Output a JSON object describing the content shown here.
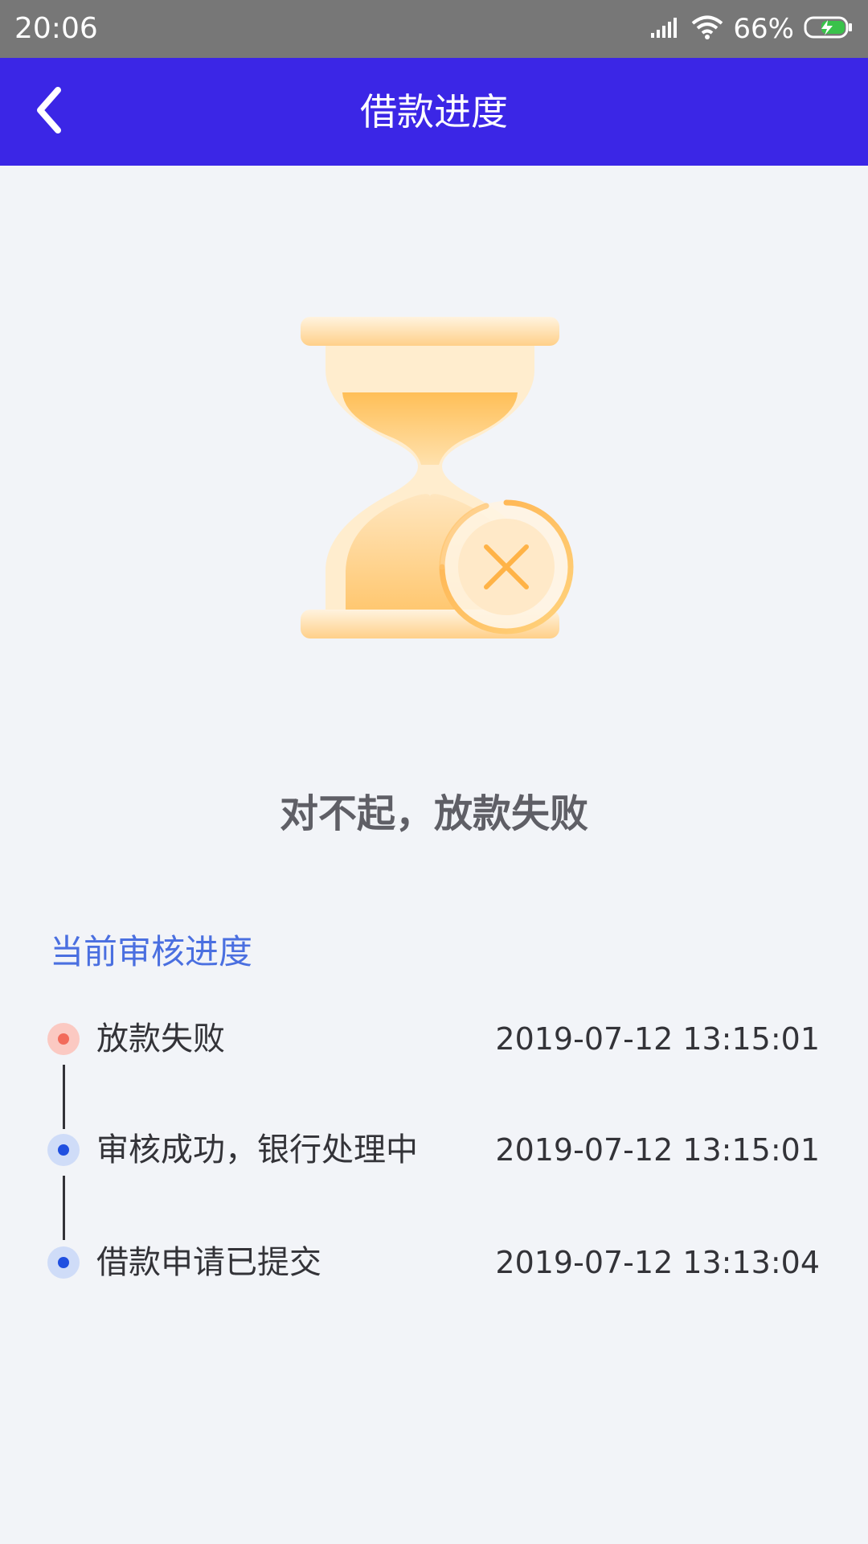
{
  "status_bar": {
    "time": "20:06",
    "battery_percent": "66%",
    "icons": [
      "signal-icon",
      "wifi-icon",
      "battery-charging-icon"
    ]
  },
  "nav": {
    "back_icon": "back-chevron-icon",
    "title": "借款进度"
  },
  "illustration": {
    "icon": "hourglass-failed-icon"
  },
  "result": {
    "title": "对不起，放款失败"
  },
  "progress": {
    "section_title": "当前审核进度",
    "items": [
      {
        "label": "放款失败",
        "time": "2019-07-12 13:15:01",
        "status": "failed"
      },
      {
        "label": "审核成功，银行处理中",
        "time": "2019-07-12 13:15:01",
        "status": "done"
      },
      {
        "label": "借款申请已提交",
        "time": "2019-07-12 13:13:04",
        "status": "done"
      }
    ]
  },
  "colors": {
    "nav_background": "#3b26e6",
    "status_bar": "#777777",
    "page_background": "#f2f4f8",
    "section_title": "#4a6fe0",
    "failed_dot": "#f26b5b",
    "done_dot": "#1f4fe0"
  }
}
